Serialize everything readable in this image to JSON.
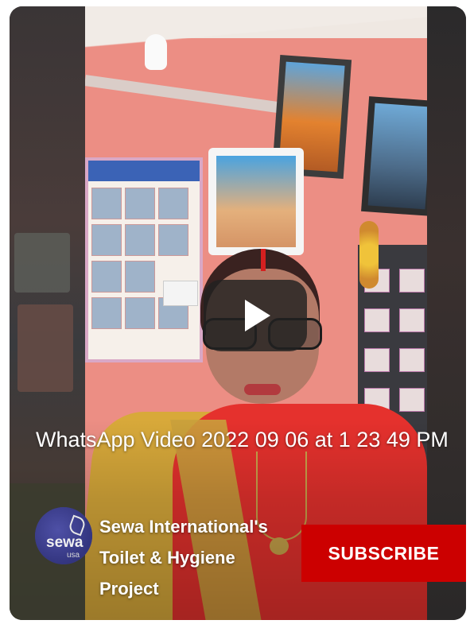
{
  "video": {
    "title": "WhatsApp Video 2022 09 06 at 1 23 49 PM"
  },
  "channel": {
    "name": "Sewa International's Toilet & Hygiene Project",
    "avatar_text": "sewa",
    "avatar_subtext": "usa"
  },
  "subscribe": {
    "label": "SUBSCRIBE",
    "color": "#cc0000"
  },
  "icons": {
    "play": "play-icon"
  }
}
